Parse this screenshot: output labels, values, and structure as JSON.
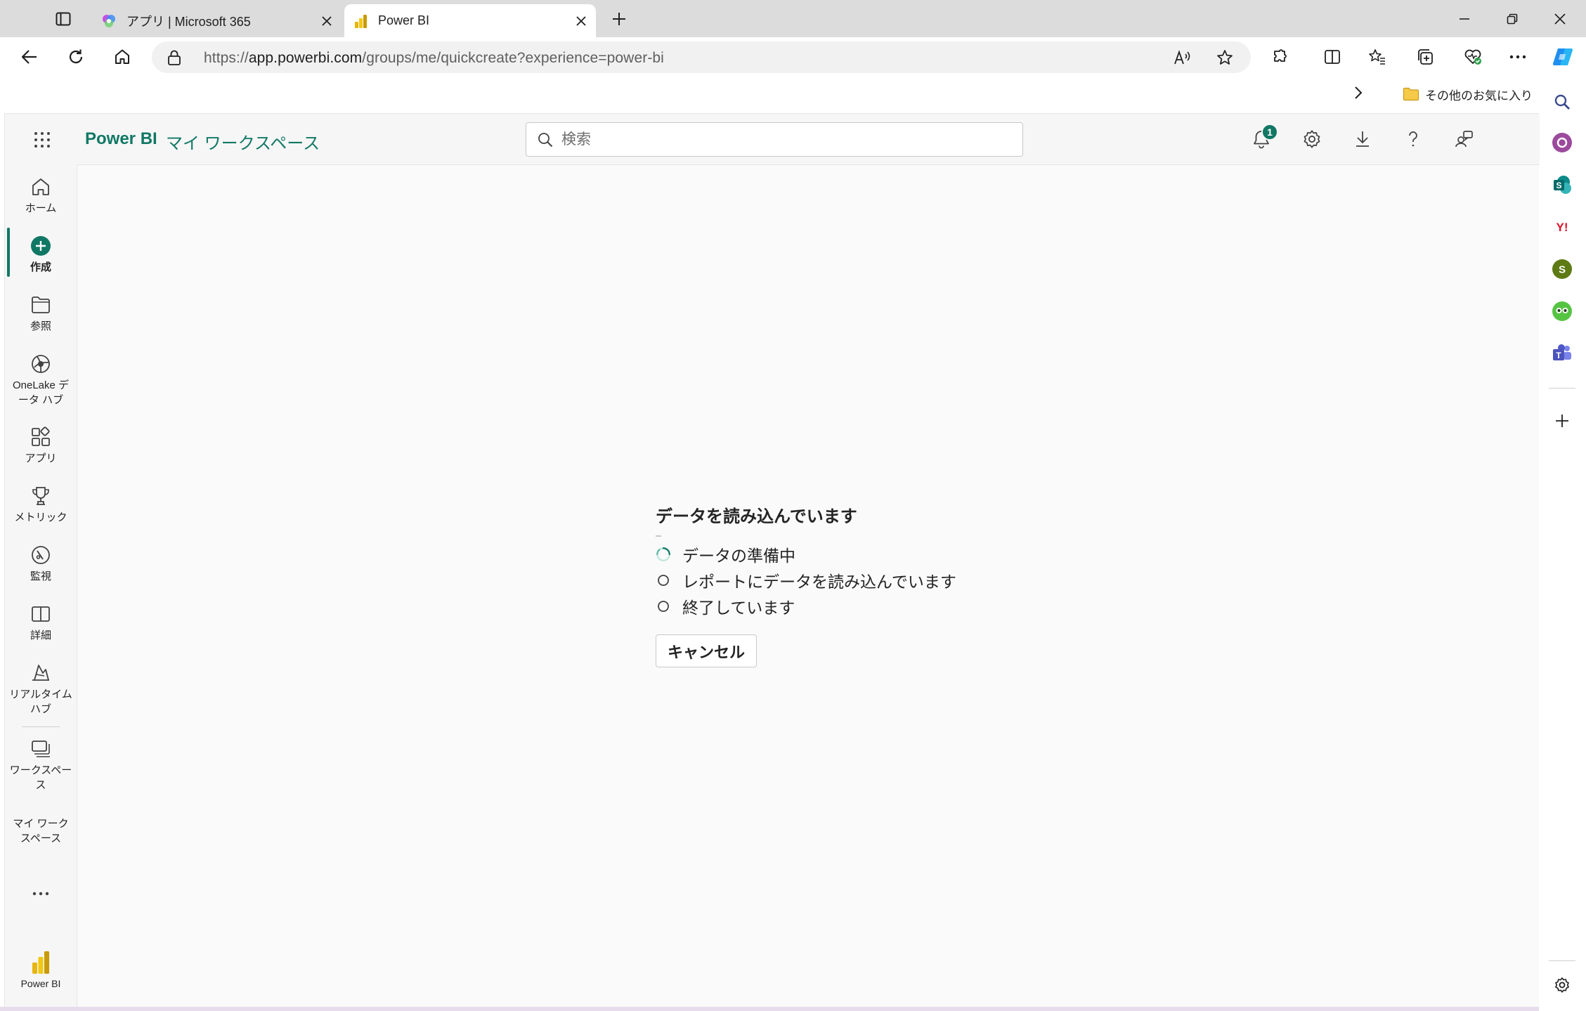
{
  "browser": {
    "tabs": [
      {
        "title": "アプリ | Microsoft 365",
        "active": false
      },
      {
        "title": "Power BI",
        "active": true
      }
    ],
    "url_prefix": "https://",
    "url_host": "app.powerbi.com",
    "url_path": "/groups/me/quickcreate?experience=power-bi",
    "favorites_folder": "その他のお気に入り"
  },
  "app": {
    "brand": "Power BI",
    "breadcrumb": "マイ ワークスペース",
    "search_placeholder": "検索",
    "notification_count": "1",
    "accent": "#117865"
  },
  "nav": {
    "home": "ホーム",
    "create": "作成",
    "browse": "参照",
    "onelake": "OneLake データ ハブ",
    "apps": "アプリ",
    "metrics": "メトリック",
    "monitor": "監視",
    "learn": "詳細",
    "realtime": "リアルタイム ハブ",
    "workspaces": "ワークスペース",
    "my_workspace": "マイ ワークスペース",
    "more": "…",
    "footer": "Power BI"
  },
  "loading": {
    "title": "データを読み込んでいます",
    "steps": [
      {
        "label": "データの準備中",
        "state": "in-progress"
      },
      {
        "label": "レポートにデータを読み込んでいます",
        "state": "pending"
      },
      {
        "label": "終了しています",
        "state": "pending"
      }
    ],
    "cancel": "キャンセル"
  }
}
